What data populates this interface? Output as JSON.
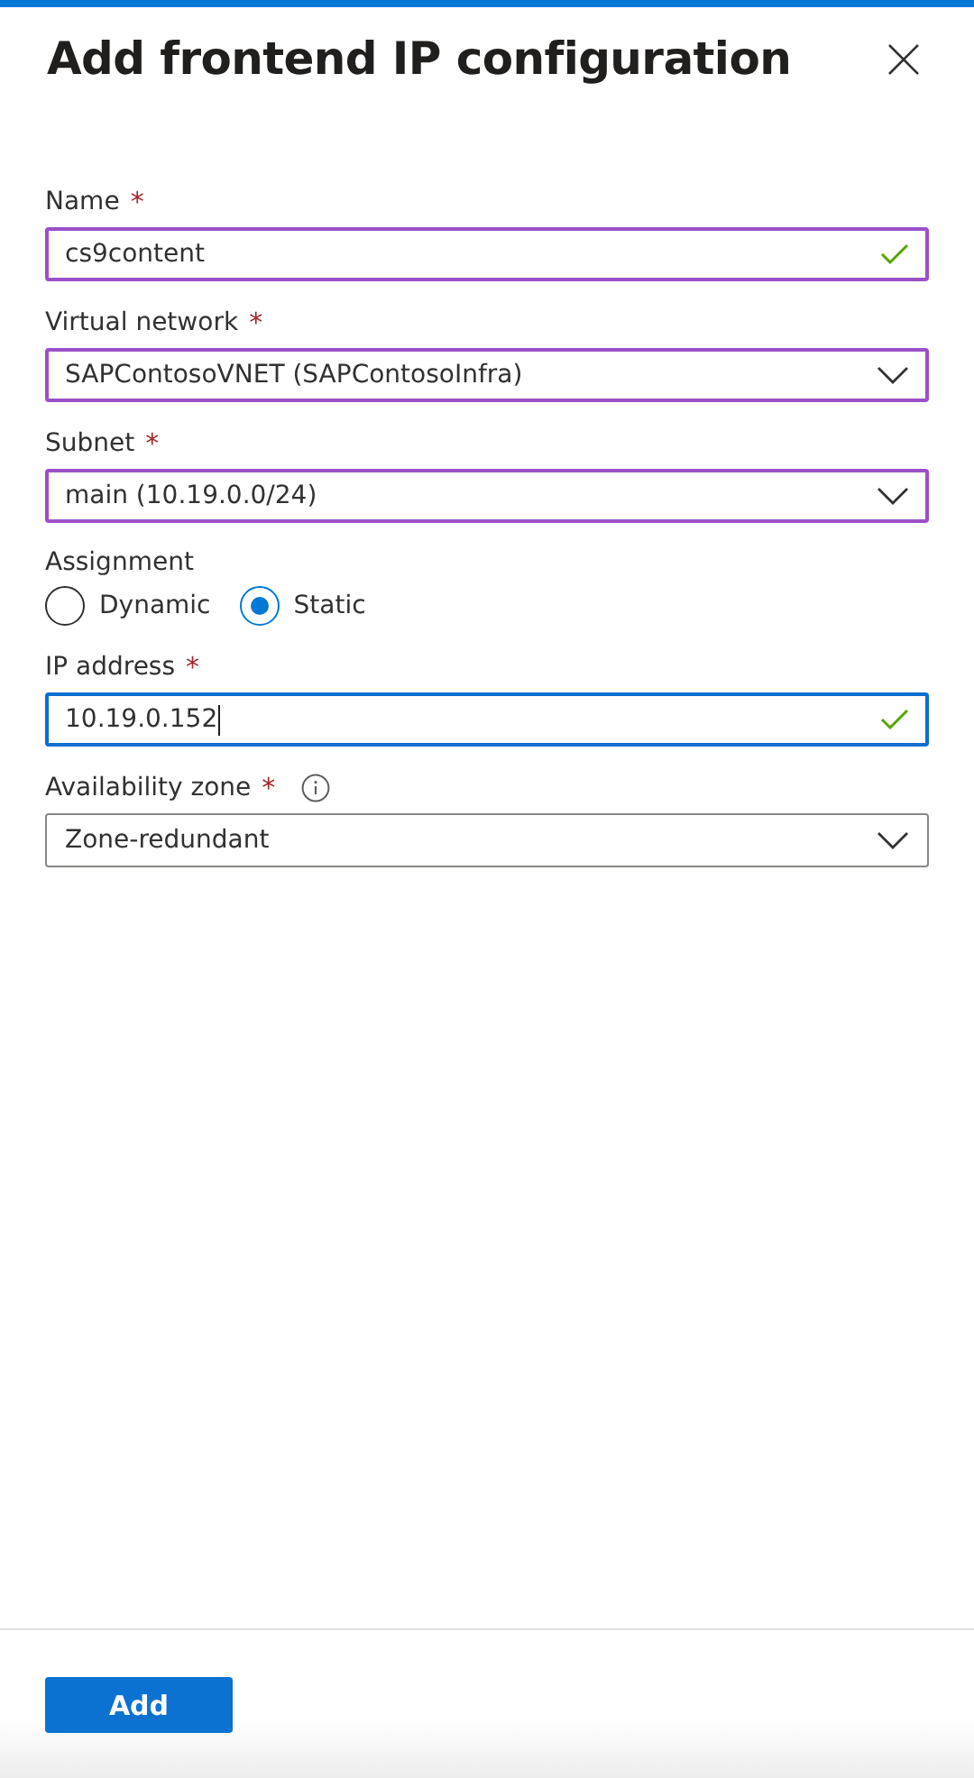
{
  "panel": {
    "title": "Add frontend IP configuration"
  },
  "fields": [
    {
      "kind": "text",
      "label": "Name",
      "required_mark": "*",
      "value": "cs9content",
      "valid": true,
      "focused": false,
      "highlighted": true
    },
    {
      "kind": "dropdown",
      "label": "Virtual network",
      "required_mark": "*",
      "value": "SAPContosoVNET (SAPContosoInfra)",
      "focused": false,
      "highlighted": true
    },
    {
      "kind": "dropdown",
      "label": "Subnet",
      "required_mark": "*",
      "value": "main (10.19.0.0/24)",
      "focused": false,
      "highlighted": true
    },
    {
      "kind": "radio",
      "label": "Assignment",
      "options": [
        {
          "label": "Dynamic",
          "selected": false
        },
        {
          "label": "Static",
          "selected": true
        }
      ]
    },
    {
      "kind": "text",
      "label": "IP address",
      "required_mark": "*",
      "value": "10.19.0.152",
      "valid": true,
      "focused": true
    },
    {
      "kind": "dropdown",
      "label": "Availability zone",
      "required_mark": "*",
      "value": "Zone-redundant",
      "focused": false,
      "highlighted": false,
      "info": true
    }
  ],
  "footer": {
    "buttons": [
      {
        "label": "Add"
      }
    ]
  }
}
